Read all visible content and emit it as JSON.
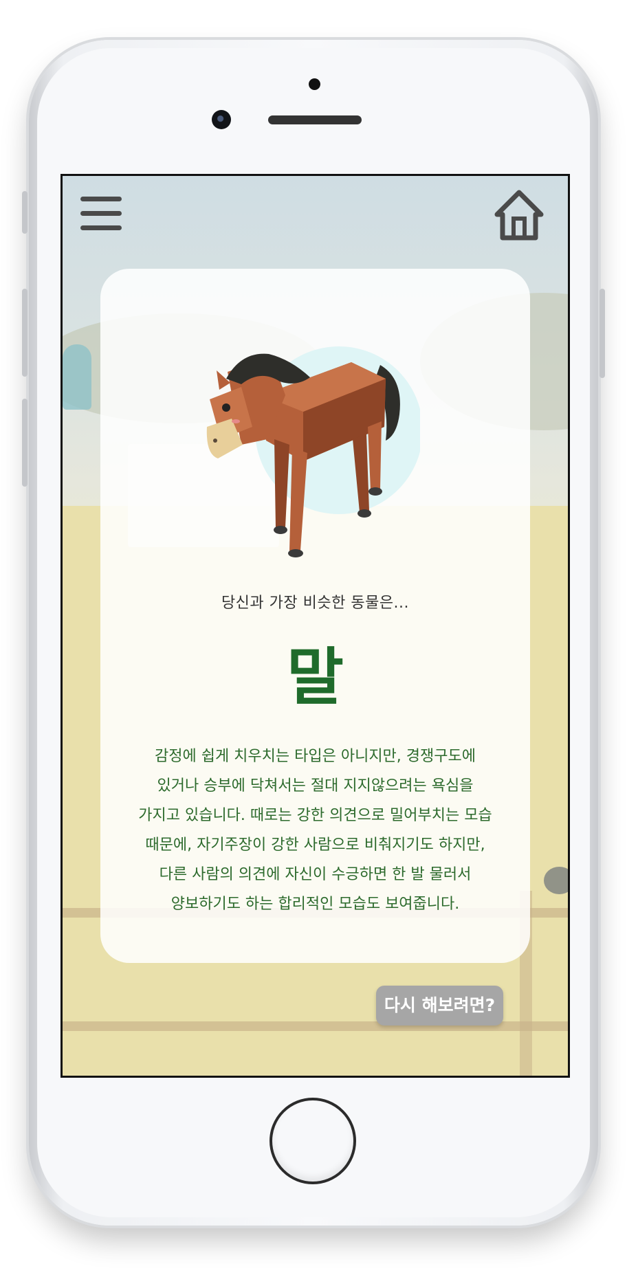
{
  "screen": {
    "menu_icon": "hamburger-menu-icon",
    "home_icon": "home-icon",
    "result": {
      "subtitle": "당신과 가장 비슷한 동물은...",
      "animal_name": "말",
      "animal_image": "horse-illustration",
      "description": "감정에 쉽게 치우치는 타입은 아니지만, 경쟁구도에\n있거나 승부에 닥쳐서는 절대 지지않으려는 욕심을\n가지고 있습니다. 때로는 강한 의견으로 밀어부치는 모습\n때문에, 자기주장이 강한 사람으로 비춰지기도 하지만,\n다른 사람의 의견에 자신이 수긍하면 한 발 물러서\n양보하기도 하는 합리적인 모습도 보여줍니다."
    },
    "retry_button": "다시 해보려면?"
  },
  "colors": {
    "title_green": "#1f6b2b",
    "text_green": "#2c6a2c",
    "button_gray": "#a6a6a6"
  }
}
